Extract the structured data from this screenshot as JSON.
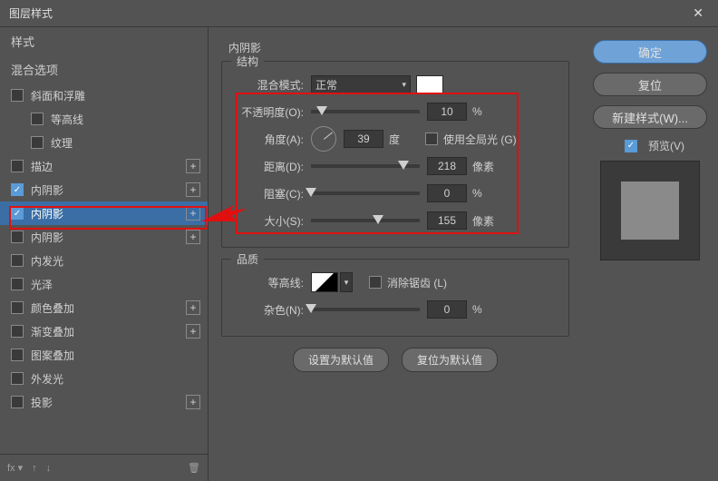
{
  "titlebar": {
    "title": "图层样式"
  },
  "sidebar": {
    "header1": "样式",
    "header2": "混合选项",
    "items": [
      {
        "label": "斜面和浮雕",
        "checked": false,
        "plus": false
      },
      {
        "label": "等高线",
        "checked": false,
        "plus": false,
        "indent": true
      },
      {
        "label": "纹理",
        "checked": false,
        "plus": false,
        "indent": true
      },
      {
        "label": "描边",
        "checked": false,
        "plus": true
      },
      {
        "label": "内阴影",
        "checked": true,
        "plus": true
      },
      {
        "label": "内阴影",
        "checked": true,
        "plus": true,
        "selected": true
      },
      {
        "label": "内阴影",
        "checked": false,
        "plus": true
      },
      {
        "label": "内发光",
        "checked": false,
        "plus": false
      },
      {
        "label": "光泽",
        "checked": false,
        "plus": false
      },
      {
        "label": "颜色叠加",
        "checked": false,
        "plus": true
      },
      {
        "label": "渐变叠加",
        "checked": false,
        "plus": true
      },
      {
        "label": "图案叠加",
        "checked": false,
        "plus": false
      },
      {
        "label": "外发光",
        "checked": false,
        "plus": false
      },
      {
        "label": "投影",
        "checked": false,
        "plus": true
      }
    ],
    "footer": {
      "fx": "fx"
    }
  },
  "panel": {
    "title": "内阴影",
    "structure": {
      "group": "结构",
      "blend_label": "混合模式:",
      "blend_value": "正常",
      "opacity_label": "不透明度(O):",
      "opacity_value": "10",
      "opacity_unit": "%",
      "angle_label": "角度(A):",
      "angle_value": "39",
      "angle_unit": "度",
      "global_label": "使用全局光 (G)",
      "distance_label": "距离(D):",
      "distance_value": "218",
      "distance_unit": "像素",
      "choke_label": "阻塞(C):",
      "choke_value": "0",
      "choke_unit": "%",
      "size_label": "大小(S):",
      "size_value": "155",
      "size_unit": "像素"
    },
    "quality": {
      "group": "品质",
      "contour_label": "等高线:",
      "antialias_label": "消除锯齿 (L)",
      "noise_label": "杂色(N):",
      "noise_value": "0",
      "noise_unit": "%"
    },
    "buttons": {
      "reset_default": "设置为默认值",
      "revert_default": "复位为默认值"
    }
  },
  "right": {
    "ok": "确定",
    "cancel": "复位",
    "new_style": "新建样式(W)...",
    "preview": "预览(V)"
  }
}
